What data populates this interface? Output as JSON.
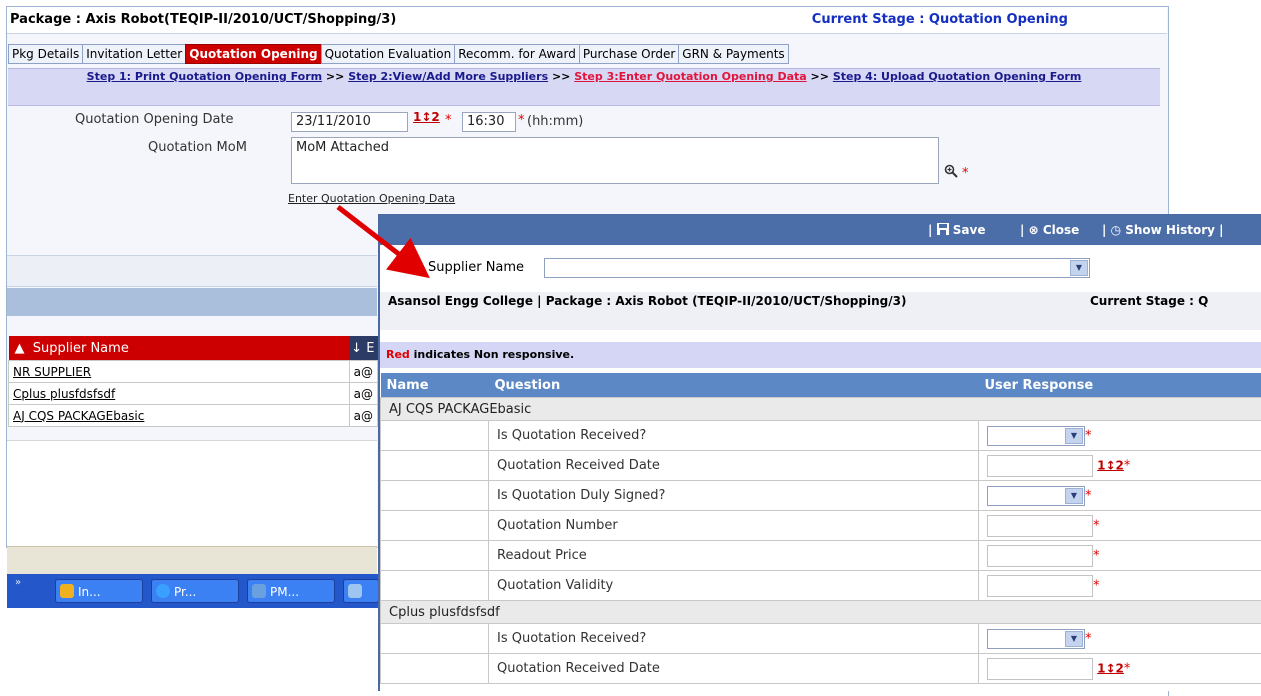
{
  "header": {
    "package_title": "Package : Axis Robot(TEQIP-II/2010/UCT/Shopping/3)",
    "current_stage": "Current Stage : Quotation Opening"
  },
  "tabs": [
    {
      "label": "Pkg Details",
      "active": false
    },
    {
      "label": "Invitation Letter",
      "active": false
    },
    {
      "label": "Quotation Opening",
      "active": true
    },
    {
      "label": "Quotation Evaluation",
      "active": false
    },
    {
      "label": "Recomm. for Award",
      "active": false
    },
    {
      "label": "Purchase Order",
      "active": false
    },
    {
      "label": "GRN & Payments",
      "active": false
    }
  ],
  "steps": {
    "step1": "Step 1: Print Quotation Opening Form",
    "sep": ">>",
    "step2": "Step 2:View/Add More Suppliers",
    "step3": "Step 3:Enter Quotation Opening Data",
    "step4": "Step 4: Upload Quotation Opening Form"
  },
  "form": {
    "date_label": "Quotation Opening Date",
    "date_value": "23/11/2010",
    "calendar_label": "1↕2",
    "time_value": "16:30",
    "time_hint": "(hh:mm)",
    "mom_label": "Quotation MoM",
    "mom_value": "MoM Attached",
    "required_mark": "*"
  },
  "enter_link": "Enter Quotation Opening Data",
  "supplier_list": {
    "header": "Supplier Name",
    "second_header": "E",
    "rows": [
      {
        "name": "NR SUPPLIER",
        "email": "a@"
      },
      {
        "name": "Cplus plusfdsfsdf",
        "email": "a@"
      },
      {
        "name": "AJ CQS PACKAGEbasic",
        "email": "a@"
      }
    ]
  },
  "taskbar": {
    "arrows": "»",
    "items": [
      {
        "label": "In...",
        "color": "#f0b020"
      },
      {
        "label": "Pr...",
        "color": "#3aa0ff"
      },
      {
        "label": "PM...",
        "color": "#6aa0e0"
      }
    ]
  },
  "popup": {
    "toolbar": {
      "save": "Save",
      "close": "Close",
      "history": "Show History"
    },
    "supplier_label": "Supplier Name",
    "supplier_value": "",
    "head_left": "Asansol Engg College | Package : Axis Robot (TEQIP-II/2010/UCT/Shopping/3)",
    "head_right": "Current Stage : Q",
    "legend_red": "Red",
    "legend_rest": " indicates Non responsive.",
    "columns": {
      "name": "Name",
      "question": "Question",
      "response": "User Response"
    },
    "groups": [
      {
        "supplier": "AJ CQS PACKAGEbasic",
        "questions": [
          {
            "text": "Is Quotation Received?",
            "type": "select"
          },
          {
            "text": "Quotation Received Date",
            "type": "date"
          },
          {
            "text": "Is Quotation Duly Signed?",
            "type": "select"
          },
          {
            "text": "Quotation Number",
            "type": "text"
          },
          {
            "text": "Readout Price",
            "type": "text"
          },
          {
            "text": "Quotation Validity",
            "type": "text"
          }
        ]
      },
      {
        "supplier": "Cplus plusfdsfsdf",
        "questions": [
          {
            "text": "Is Quotation Received?",
            "type": "select"
          },
          {
            "text": "Quotation Received Date",
            "type": "date"
          }
        ]
      }
    ]
  },
  "colors": {
    "active_tab": "#cc0000",
    "stage_text": "#1530c0",
    "step_active": "#e0143c",
    "annotation_arrow": "#e00000",
    "popup_toolbar": "#4c6ea8",
    "table_header": "#5c88c6"
  }
}
